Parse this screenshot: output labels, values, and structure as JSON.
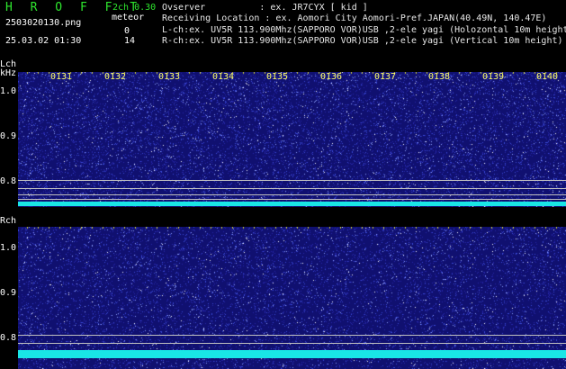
{
  "header": {
    "app_title": "H R O F F T",
    "version": "2ch 0.30",
    "filename": "2503020130.png",
    "meteor_label": "meteor",
    "count_l": "0",
    "count_r": "14",
    "datetime": "25.03.02 01:30",
    "info_lines": [
      "Ovserver          : ex. JR7CYX [ kid ]",
      "Receiving Location : ex. Aomori City Aomori-Pref.JAPAN(40.49N, 140.47E)",
      "L-ch:ex. UV5R 113.900Mhz(SAPPORO VOR)USB ,2-ele yagi (Holozontal 10m height)",
      "R-ch:ex. UV5R 113.900Mhz(SAPPORO VOR)USB ,2-ele yagi (Vertical 10m height)"
    ]
  },
  "lch": {
    "label": "Lch",
    "unit": "kHz",
    "yticks": [
      "1.0",
      "0.9",
      "0.8"
    ]
  },
  "rch": {
    "label": "Rch",
    "yticks": [
      "1.0",
      "0.9",
      "0.8"
    ]
  },
  "time_ticks": [
    "0131",
    "0132",
    "0133",
    "0134",
    "0135",
    "0136",
    "0137",
    "0138",
    "0139",
    "0140"
  ],
  "colors": {
    "background": "#000000",
    "spectrogram": "#1a1a8c",
    "noise_band": "#19e6e6",
    "title": "#2ee62e",
    "tick_label": "#ffff66"
  }
}
